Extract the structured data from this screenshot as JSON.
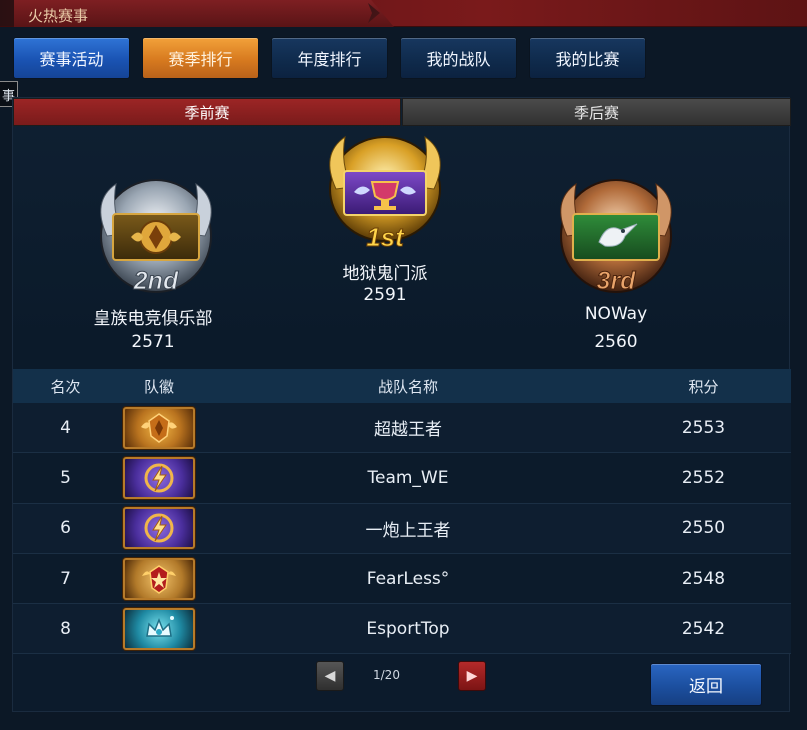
{
  "header": {
    "title": "火热赛事"
  },
  "nav": {
    "items": [
      {
        "label": "赛事活动"
      },
      {
        "label": "赛季排行"
      },
      {
        "label": "年度排行"
      },
      {
        "label": "我的战队"
      },
      {
        "label": "我的比赛"
      }
    ],
    "active_index": 1
  },
  "side_tip": {
    "text": "事"
  },
  "season_tabs": {
    "preseason": "季前赛",
    "postseason": "季后赛",
    "active": "preseason"
  },
  "podium": {
    "first": {
      "rank_text": "1st",
      "name": "地狱鬼门派",
      "score": "2591"
    },
    "second": {
      "rank_text": "2nd",
      "name": "皇族电竞俱乐部",
      "score": "2571"
    },
    "third": {
      "rank_text": "3rd",
      "name": "NOWay",
      "score": "2560"
    }
  },
  "table": {
    "headers": {
      "rank": "名次",
      "badge": "队徽",
      "team": "战队名称",
      "points": "积分"
    },
    "rows": [
      {
        "rank": "4",
        "badge_icon": "gold-shield-wings-icon",
        "team": "超越王者",
        "points": "2553"
      },
      {
        "rank": "5",
        "badge_icon": "purple-lightning-icon",
        "team": "Team_WE",
        "points": "2552"
      },
      {
        "rank": "6",
        "badge_icon": "purple-lightning-icon",
        "team": "一炮上王者",
        "points": "2550"
      },
      {
        "rank": "7",
        "badge_icon": "red-star-crest-icon",
        "team": "FearLess°",
        "points": "2548"
      },
      {
        "rank": "8",
        "badge_icon": "cyan-crystal-crown-icon",
        "team": "EsportTop",
        "points": "2542"
      }
    ]
  },
  "pagination": {
    "indicator": "1/20"
  },
  "actions": {
    "back_label": "返回"
  },
  "colors": {
    "accent_blue": "#1a53b3",
    "accent_orange": "#d77a1f",
    "season_active": "#8a2020",
    "gold": "#d8a22a",
    "silver": "#b9c2cc",
    "bronze": "#b06a39"
  }
}
